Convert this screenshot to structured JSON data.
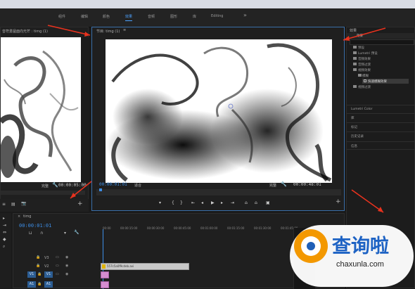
{
  "menubar": {
    "items": [
      "组件",
      "编辑",
      "颜色",
      "效果",
      "音频",
      "图形",
      "库"
    ],
    "editing_label": "Editing",
    "more_glyph": "»"
  },
  "source_monitor": {
    "title": "音符勇猛面向光芒 : timg (1)",
    "fit_label": "完整",
    "duration": "00:00:05:00"
  },
  "program_monitor": {
    "title": "节目: timg (1)",
    "menu_glyph": "≡",
    "timecode": "00:00:01:01",
    "fit_label": "适合",
    "quality_label": "完整",
    "duration": "00:00:48:01"
  },
  "effects_panel": {
    "title": "效果",
    "tab_label": "效果",
    "tree": [
      {
        "label": "预设",
        "level": 0
      },
      {
        "label": "Lumetri 预设",
        "level": 0
      },
      {
        "label": "音频效果",
        "level": 0
      },
      {
        "label": "音频过渡",
        "level": 0
      },
      {
        "label": "视频效果",
        "level": 0
      },
      {
        "label": "模糊",
        "level": 1
      },
      {
        "label": "快速模糊效果",
        "level": 2,
        "selected": true
      },
      {
        "label": "视频过渡",
        "level": 0
      }
    ],
    "sections": [
      "Lumetri Color",
      "库",
      "标记",
      "历史记录",
      "信息"
    ]
  },
  "project_panel": {
    "buttons": [
      "≡",
      "▤",
      "📷"
    ]
  },
  "timeline": {
    "sequence_name": "timg",
    "timecode": "00:00:01:01",
    "ruler_labels": [
      "00:00",
      "00:00:15:00",
      "00:00:30:00",
      "00:00:45:00",
      "00:01:00:00",
      "00:01:15:00",
      "00:01:30:00",
      "00:01:45:00"
    ],
    "tracks": [
      {
        "name": "V3",
        "target": ""
      },
      {
        "name": "V2",
        "target": ""
      },
      {
        "name": "V1",
        "target": "V1"
      },
      {
        "name": "A1",
        "target": "A1"
      }
    ],
    "clip_label": "557c5a0f9cdeb.avi"
  },
  "watermark": {
    "brand": "查询啦",
    "url": "chaxunla.com"
  },
  "colors": {
    "accent": "#3d8ee6",
    "arrow": "#e8321e",
    "clip_pink": "#d58cd0",
    "watermark_orange": "#f39800"
  }
}
